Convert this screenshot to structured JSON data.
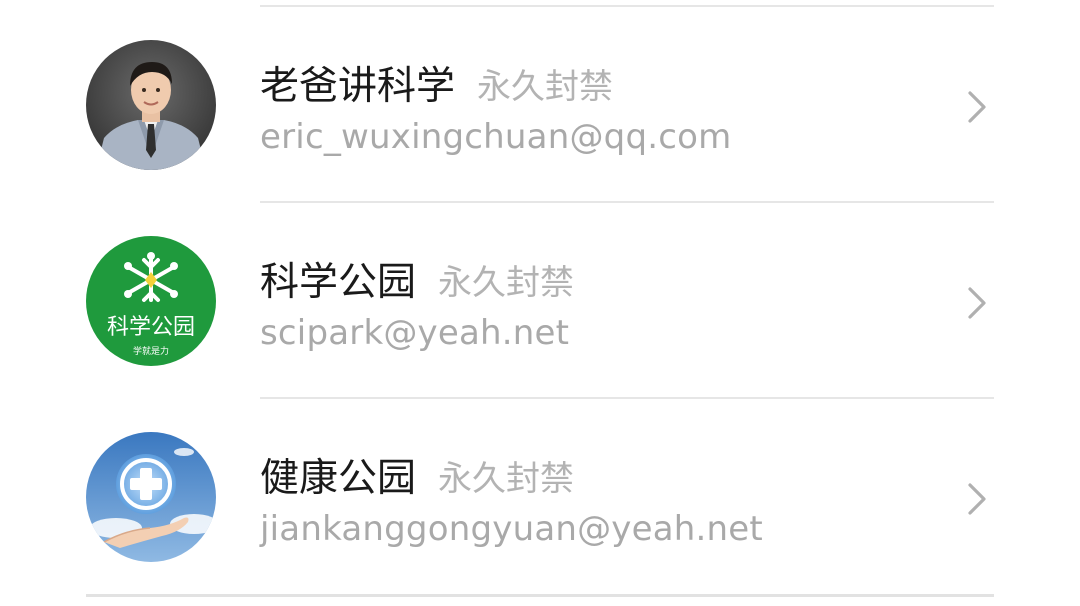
{
  "contacts": [
    {
      "name": "老爸讲科学",
      "status": "永久封禁",
      "email": "eric_wuxingchuan@qq.com",
      "avatar_icon": "man-in-suit-avatar"
    },
    {
      "name": "科学公园",
      "status": "永久封禁",
      "email": "scipark@yeah.net",
      "avatar_icon": "science-park-logo",
      "avatar_text": "科学公园",
      "avatar_subtext": "学就是力",
      "avatar_color": "#1f9a3d"
    },
    {
      "name": "健康公园",
      "status": "永久封禁",
      "email": "jiankanggongyuan@yeah.net",
      "avatar_icon": "health-cross-hand-logo",
      "avatar_color": "#3d7fc4"
    }
  ],
  "colors": {
    "name_text": "#1a1a1a",
    "status_text": "#b3b3b3",
    "email_text": "#a9a9a9",
    "divider": "#e6e6e6",
    "chevron": "#b0b0b0"
  }
}
